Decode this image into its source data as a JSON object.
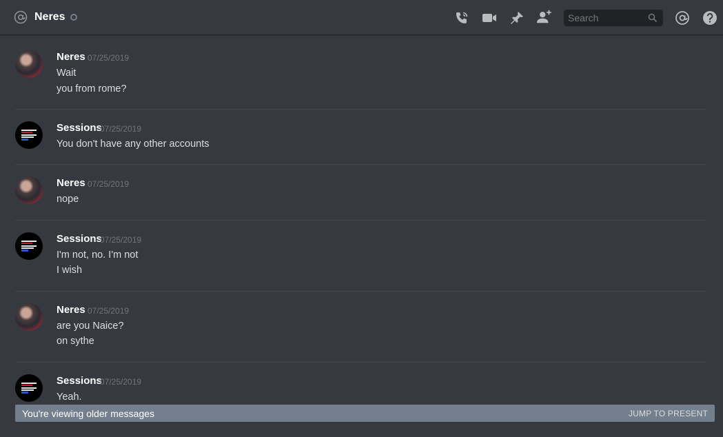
{
  "header": {
    "channel_name": "Neres",
    "search_placeholder": "Search",
    "icons": [
      "at-icon",
      "call-icon",
      "video-icon",
      "pin-icon",
      "add-friend-icon",
      "search-icon",
      "mentions-icon",
      "help-icon"
    ]
  },
  "messages": [
    {
      "author": "Neres",
      "timestamp": "07/25/2019",
      "lines": [
        "Wait",
        "you from rome?"
      ]
    },
    {
      "author": "Sessions",
      "timestamp": "07/25/2019",
      "lines": [
        "You don't have any other accounts"
      ]
    },
    {
      "author": "Neres",
      "timestamp": "07/25/2019",
      "lines": [
        "nope"
      ]
    },
    {
      "author": "Sessions",
      "timestamp": "07/25/2019",
      "lines": [
        "I'm not, no. I'm not",
        "I wish"
      ]
    },
    {
      "author": "Neres",
      "timestamp": "07/25/2019",
      "lines": [
        "are you Naice?",
        "on sythe"
      ]
    },
    {
      "author": "Sessions",
      "timestamp": "07/25/2019",
      "lines": [
        "Yeah."
      ]
    }
  ],
  "older_bar": {
    "text": "You're viewing older messages",
    "jump_label": "JUMP TO PRESENT"
  },
  "colors": {
    "background": "#36393f",
    "older_bar": "#747f8d",
    "timestamp": "#72767d"
  }
}
